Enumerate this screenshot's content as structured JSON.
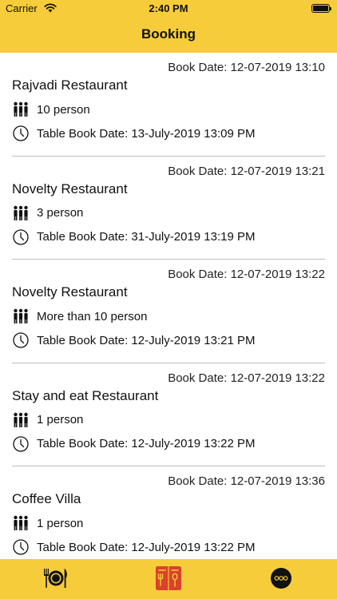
{
  "status_bar": {
    "carrier": "Carrier",
    "time": "2:40 PM"
  },
  "nav": {
    "title": "Booking"
  },
  "bookings": [
    {
      "book_date": "Book Date: 12-07-2019 13:10",
      "restaurant": "Rajvadi Restaurant",
      "people": "10 person",
      "table_date": "Table Book Date: 13-July-2019 13:09 PM"
    },
    {
      "book_date": "Book Date: 12-07-2019 13:21",
      "restaurant": "Novelty Restaurant",
      "people": "3 person",
      "table_date": "Table Book Date: 31-July-2019 13:19 PM"
    },
    {
      "book_date": "Book Date: 12-07-2019 13:22",
      "restaurant": "Novelty Restaurant",
      "people": "More than 10 person",
      "table_date": "Table Book Date: 12-July-2019 13:21 PM"
    },
    {
      "book_date": "Book Date: 12-07-2019 13:22",
      "restaurant": "Stay and eat Restaurant",
      "people": "1 person",
      "table_date": "Table Book Date: 12-July-2019 13:22 PM"
    },
    {
      "book_date": "Book Date: 12-07-2019 13:36",
      "restaurant": "Coffee Villa",
      "people": "1 person",
      "table_date": "Table Book Date: 12-July-2019 13:22 PM"
    }
  ],
  "tabbar": {
    "tabs": [
      {
        "icon": "fork-plate-knife-icon"
      },
      {
        "icon": "menu-book-icon",
        "color": "#D9422B"
      },
      {
        "icon": "more-icon"
      }
    ]
  },
  "colors": {
    "bar_background": "#F7CC3A",
    "divider": "#BDBDBD"
  }
}
